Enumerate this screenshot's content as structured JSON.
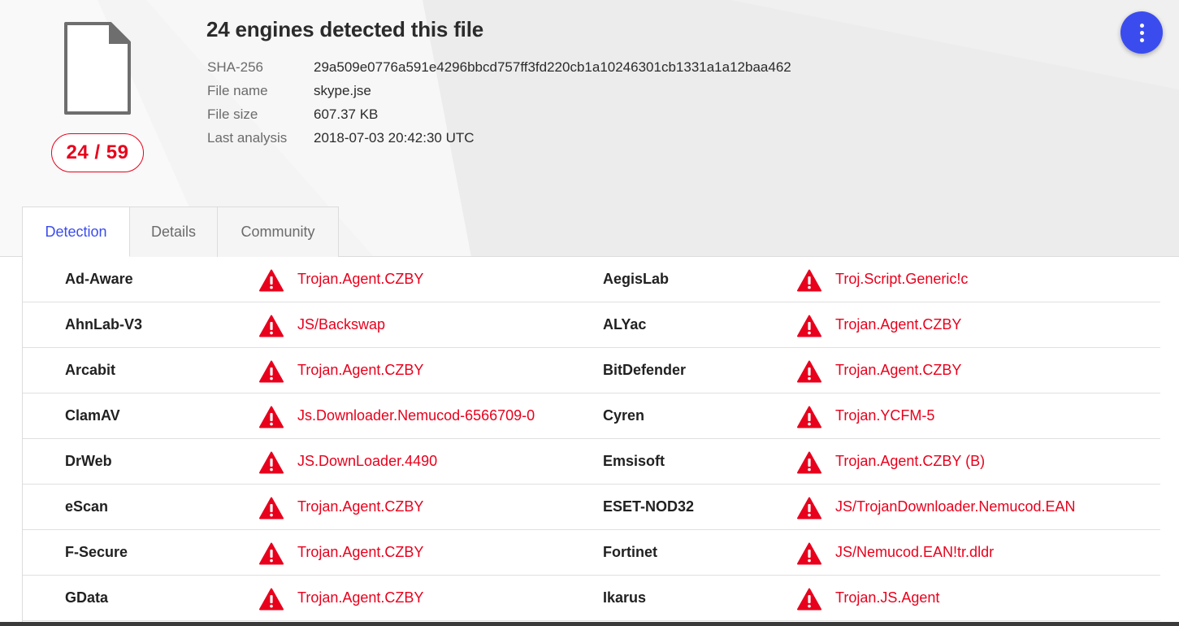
{
  "file": {
    "icon": "file-icon",
    "score": "24 / 59",
    "headline": "24 engines detected this file"
  },
  "meta": [
    {
      "key": "SHA-256",
      "value": "29a509e0776a591e4296bbcd757ff3fd220cb1a10246301cb1331a1a12baa462"
    },
    {
      "key": "File name",
      "value": "skype.jse"
    },
    {
      "key": "File size",
      "value": "607.37 KB"
    },
    {
      "key": "Last analysis",
      "value": "2018-07-03 20:42:30 UTC"
    }
  ],
  "menu": {
    "icon": "more-vertical-icon"
  },
  "tabs": [
    {
      "label": "Detection",
      "active": true
    },
    {
      "label": "Details",
      "active": false
    },
    {
      "label": "Community",
      "active": false
    }
  ],
  "colors": {
    "accent": "#3b4cef",
    "malicious": "#e8001c"
  },
  "detections": [
    {
      "left": {
        "engine": "Ad-Aware",
        "result": "Trojan.Agent.CZBY"
      },
      "right": {
        "engine": "AegisLab",
        "result": "Troj.Script.Generic!c"
      }
    },
    {
      "left": {
        "engine": "AhnLab-V3",
        "result": "JS/Backswap"
      },
      "right": {
        "engine": "ALYac",
        "result": "Trojan.Agent.CZBY"
      }
    },
    {
      "left": {
        "engine": "Arcabit",
        "result": "Trojan.Agent.CZBY"
      },
      "right": {
        "engine": "BitDefender",
        "result": "Trojan.Agent.CZBY"
      }
    },
    {
      "left": {
        "engine": "ClamAV",
        "result": "Js.Downloader.Nemucod-6566709-0"
      },
      "right": {
        "engine": "Cyren",
        "result": "Trojan.YCFM-5"
      }
    },
    {
      "left": {
        "engine": "DrWeb",
        "result": "JS.DownLoader.4490"
      },
      "right": {
        "engine": "Emsisoft",
        "result": "Trojan.Agent.CZBY (B)"
      }
    },
    {
      "left": {
        "engine": "eScan",
        "result": "Trojan.Agent.CZBY"
      },
      "right": {
        "engine": "ESET-NOD32",
        "result": "JS/TrojanDownloader.Nemucod.EAN"
      }
    },
    {
      "left": {
        "engine": "F-Secure",
        "result": "Trojan.Agent.CZBY"
      },
      "right": {
        "engine": "Fortinet",
        "result": "JS/Nemucod.EAN!tr.dldr"
      }
    },
    {
      "left": {
        "engine": "GData",
        "result": "Trojan.Agent.CZBY"
      },
      "right": {
        "engine": "Ikarus",
        "result": "Trojan.JS.Agent"
      }
    }
  ]
}
